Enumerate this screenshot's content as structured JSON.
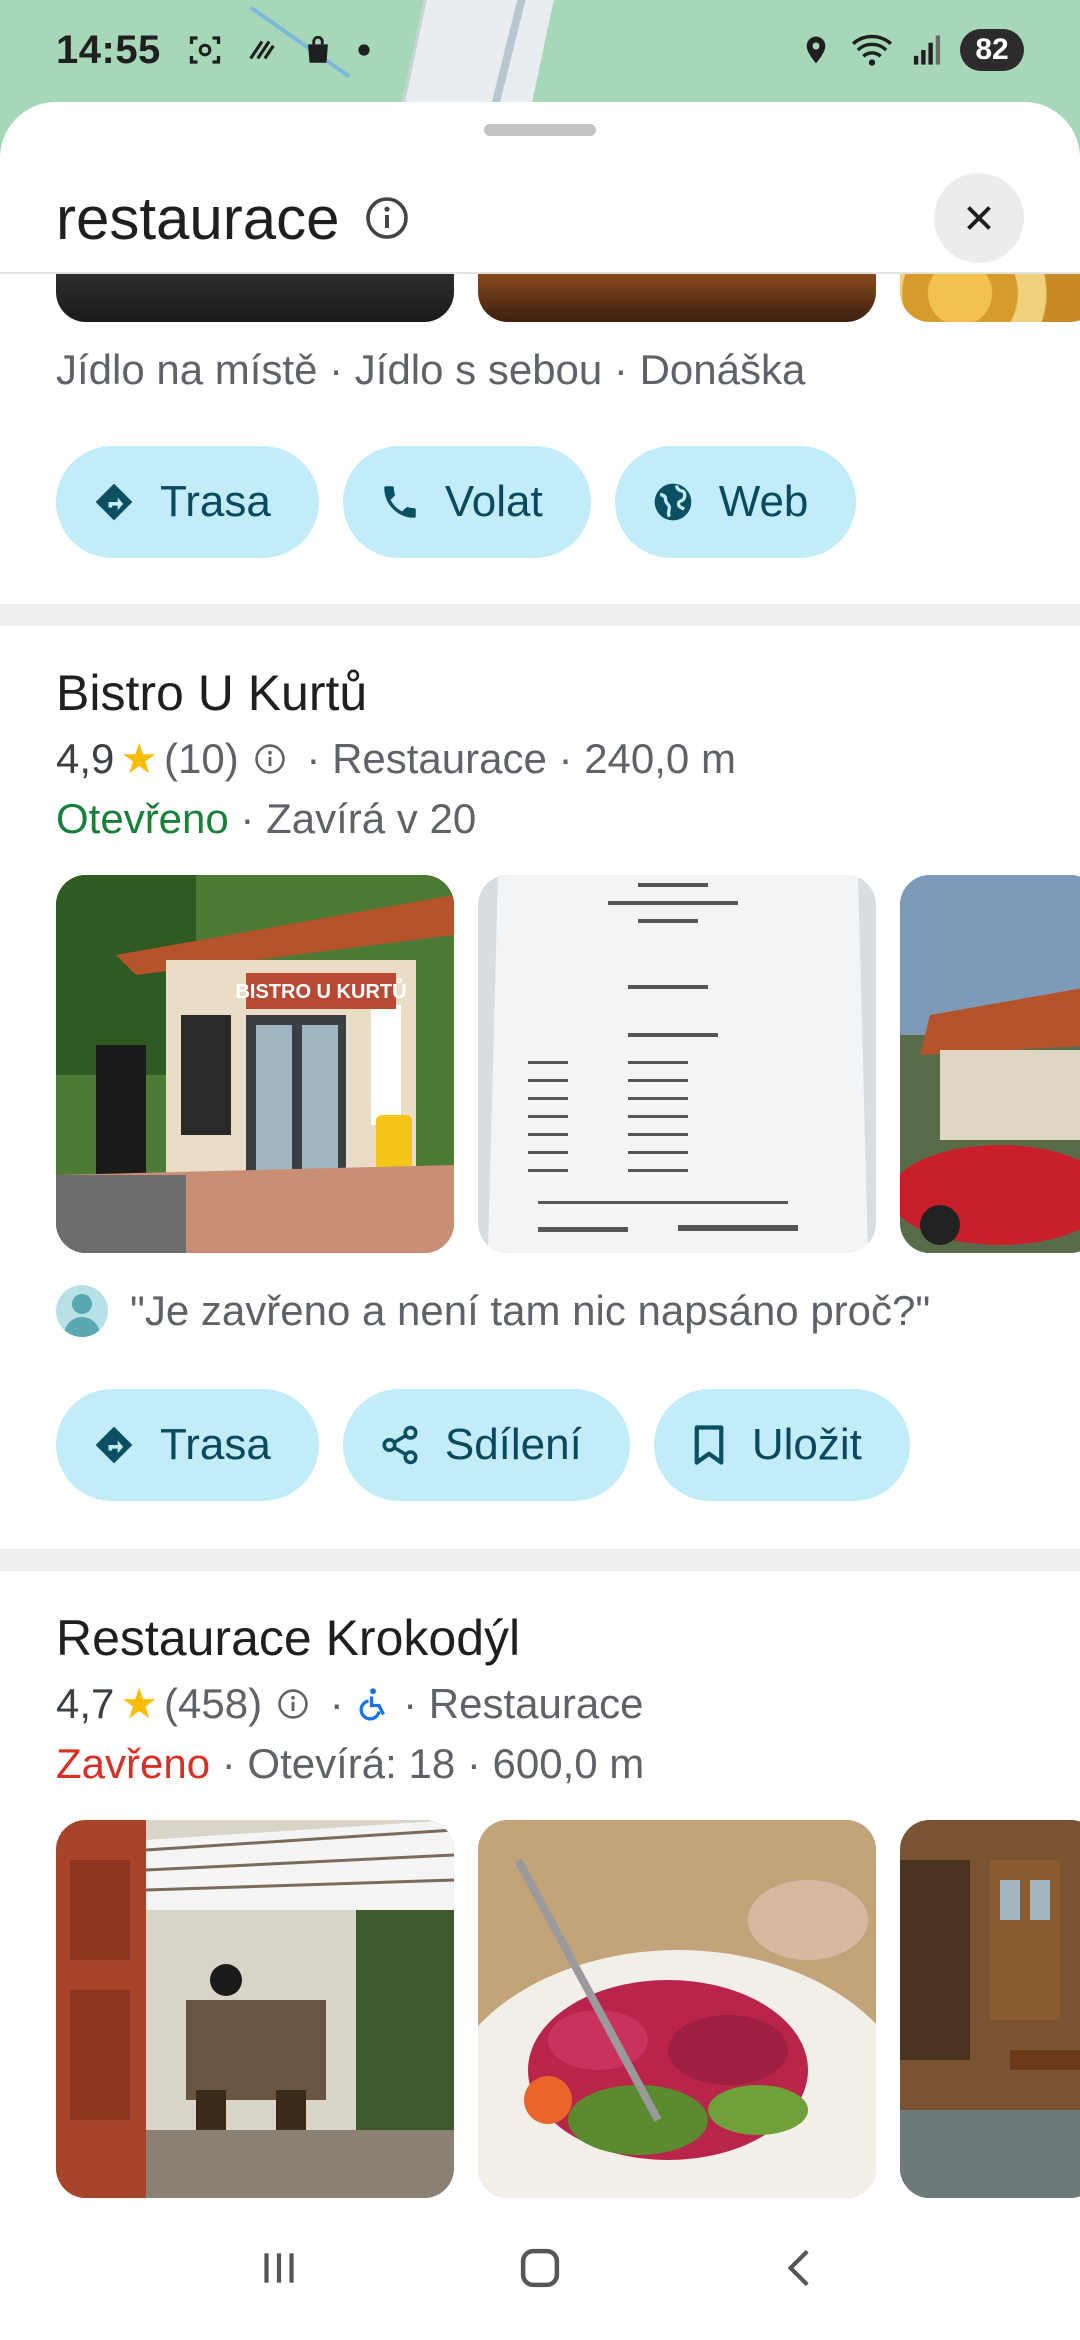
{
  "status_bar": {
    "time": "14:55",
    "battery": "82",
    "icons": [
      "screenshot-icon",
      "nfc-icon",
      "shopping-bag-icon",
      "dot-icon",
      "location-icon",
      "wifi-icon",
      "signal-icon"
    ]
  },
  "search": {
    "title": "restaurace",
    "info_icon": "info-icon",
    "close_icon": "close-icon"
  },
  "first_place": {
    "services": "Jídlo na místě · Jídlo s sebou · Donáška",
    "actions": [
      {
        "label": "Trasa",
        "icon": "directions-icon"
      },
      {
        "label": "Volat",
        "icon": "phone-icon"
      },
      {
        "label": "Web",
        "icon": "globe-icon"
      }
    ]
  },
  "places": [
    {
      "name": "Bistro U Kurtů",
      "rating": "4,9",
      "reviews": "(10)",
      "category": "Restaurace",
      "distance": "240,0 m",
      "status": "Otevřeno",
      "status_detail": "Zavírá v 20",
      "photo_sign_text": "BISTRO U KURTŮ",
      "review_snippet": "\"Je zavřeno a není tam nic napsáno proč?\"",
      "actions": [
        {
          "label": "Trasa",
          "icon": "directions-icon"
        },
        {
          "label": "Sdílení",
          "icon": "share-icon"
        },
        {
          "label": "Uložit",
          "icon": "bookmark-icon"
        }
      ]
    },
    {
      "name": "Restaurace Krokodýl",
      "rating": "4,7",
      "reviews": "(458)",
      "accessibility_icon": "wheelchair-icon",
      "category": "Restaurace",
      "status": "Zavřeno",
      "status_detail": "Otevírá: 18 · 600,0 m"
    }
  ],
  "colors": {
    "pill_bg": "#c2ecf7",
    "pill_text": "#0b4f63",
    "open": "#188038",
    "closed": "#d93025",
    "star": "#fbbc04",
    "map": "#a6d7b8"
  },
  "nav_bar": {
    "icons": [
      "recent-apps-icon",
      "home-icon",
      "back-icon"
    ]
  }
}
